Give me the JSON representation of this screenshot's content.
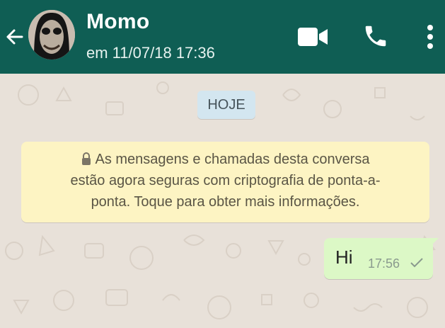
{
  "header": {
    "contact_name": "Momo",
    "last_seen": "em 11/07/18 17:36",
    "icons": {
      "back": "arrow-left-icon",
      "avatar": "contact-avatar",
      "video": "video-camera-icon",
      "call": "phone-icon",
      "menu": "more-vertical-icon"
    }
  },
  "chat": {
    "date_chip": "HOJE",
    "encryption_notice": {
      "line1": "As mensagens e chamadas desta conversa",
      "line2": "estão agora seguras com criptografia de ponta-a-",
      "line3": "ponta. Toque para obter mais informações.",
      "icon": "lock-icon"
    },
    "messages": [
      {
        "direction": "outgoing",
        "text": "Hi",
        "time": "17:56",
        "status": "sent",
        "status_icon": "single-check-icon"
      }
    ]
  },
  "colors": {
    "header": "#0f5e54",
    "chat_background": "#e8e1d9",
    "date_chip": "#d3e6f0",
    "notice": "#fdf4c3",
    "outgoing_bubble": "#dcf8c6"
  }
}
